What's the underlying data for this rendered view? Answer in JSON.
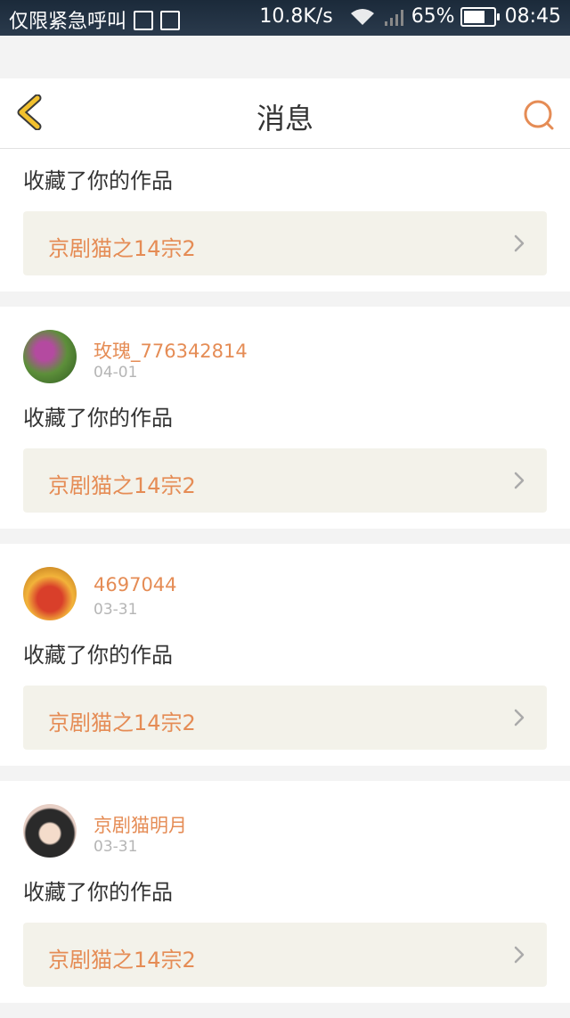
{
  "status_bar": {
    "left_text": "仅限紧急呼叫",
    "net_speed": "10.8K/s",
    "battery": "65%",
    "time": "08:45"
  },
  "header": {
    "title": "消息"
  },
  "items": [
    {
      "user": "",
      "date": "",
      "action": "收藏了你的作品",
      "work": "京剧猫之14宗2"
    },
    {
      "user": "玫瑰_776342814",
      "date": "04-01",
      "action": "收藏了你的作品",
      "work": "京剧猫之14宗2"
    },
    {
      "user": "4697044",
      "date": "03-31",
      "action": "收藏了你的作品",
      "work": "京剧猫之14宗2"
    },
    {
      "user": "京剧猫明月",
      "date": "03-31",
      "action": "收藏了你的作品",
      "work": "京剧猫之14宗2"
    }
  ],
  "colors": {
    "accent": "#e58c55",
    "back_icon": "#f2c12e",
    "card_bg": "#f3f2ea"
  }
}
